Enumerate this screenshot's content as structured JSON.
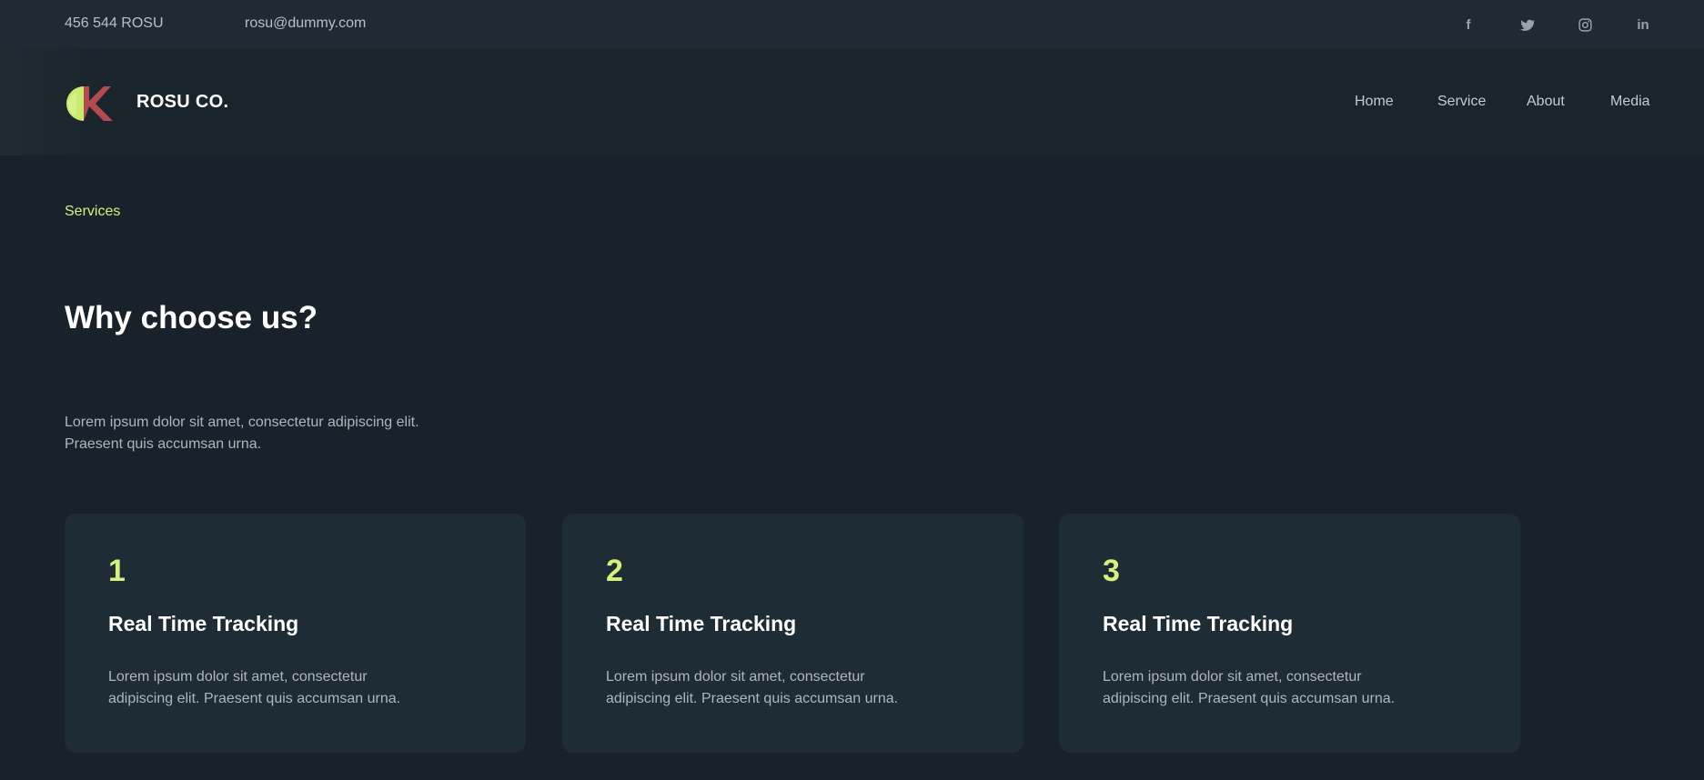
{
  "topbar": {
    "phone": "456 544 ROSU",
    "email": "rosu@dummy.com",
    "social": [
      {
        "icon": "facebook-icon",
        "glyph": "f"
      },
      {
        "icon": "twitter-icon",
        "glyph": ""
      },
      {
        "icon": "instagram-icon",
        "glyph": ""
      },
      {
        "icon": "linkedin-icon",
        "glyph": "in"
      }
    ]
  },
  "header": {
    "brand": "ROSU CO.",
    "nav": [
      "Home",
      "Service",
      "About",
      "Media"
    ]
  },
  "section": {
    "eyebrow": "Services",
    "title": "Why choose us?",
    "intro": "Lorem ipsum dolor sit amet, consectetur adipiscing elit. Praesent quis accumsan urna."
  },
  "cards": [
    {
      "number": "1",
      "title": "Real Time Tracking",
      "description": "Lorem ipsum dolor sit amet, consectetur adipiscing elit. Praesent quis accumsan urna."
    },
    {
      "number": "2",
      "title": "Real Time Tracking",
      "description": "Lorem ipsum dolor sit amet, consectetur adipiscing elit. Praesent quis accumsan urna."
    },
    {
      "number": "3",
      "title": "Real Time Tracking",
      "description": "Lorem ipsum dolor sit amet, consectetur adipiscing elit. Praesent quis accumsan urna."
    }
  ],
  "colors": {
    "background": "#19222a",
    "topbar": "#1e2b34",
    "card": "#1e2c36",
    "accent": "#d7f07b",
    "logo_green": "#c9ec6f",
    "logo_red": "#b34a4f"
  }
}
